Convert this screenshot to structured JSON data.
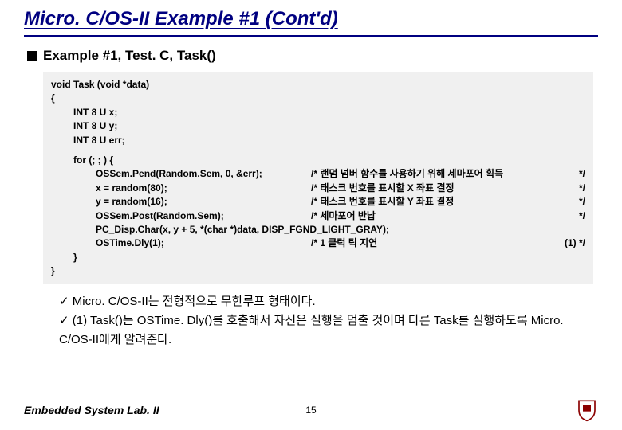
{
  "title": "Micro. C/OS-II Example #1 (Cont'd)",
  "section_heading": "Example #1, Test. C, Task()",
  "code": {
    "l0": "void Task (void *data)",
    "l1": "{",
    "l2": "INT 8 U x;",
    "l3": "INT 8 U y;",
    "l4": "INT 8 U err;",
    "l5": "for (; ; ) {",
    "l6a": "OSSem.Pend(Random.Sem, 0, &err);",
    "l6b": "/* 랜덤 넘버 함수를 사용하기 위해 세마포어 획득",
    "l6c": "*/",
    "l7a": "x = random(80);",
    "l7b": "/* 태스크 번호를 표시할 X 좌표 결정",
    "l7c": "*/",
    "l8a": "y = random(16);",
    "l8b": "/* 태스크 번호를 표시할 Y 좌표 결정",
    "l8c": "*/",
    "l9a": "OSSem.Post(Random.Sem);",
    "l9b": "/* 세마포어 반납",
    "l9c": "*/",
    "l10": "PC_Disp.Char(x, y + 5, *(char *)data, DISP_FGND_LIGHT_GRAY);",
    "l11a": "OSTime.Dly(1);",
    "l11b": "/* 1 클럭 틱 지연",
    "l11c": "(1)   */",
    "l12": "}",
    "l13": "}"
  },
  "bullets": {
    "b1": "Micro. C/OS-II는 전형적으로 무한루프 형태이다.",
    "b2": "(1) Task()는 OSTime. Dly()를 호출해서 자신은 실행을 멈출 것이며 다른 Task를 실행하도록 Micro. C/OS-II에게 알려준다."
  },
  "footer": {
    "lab": "Embedded System Lab. II",
    "page": "15"
  }
}
